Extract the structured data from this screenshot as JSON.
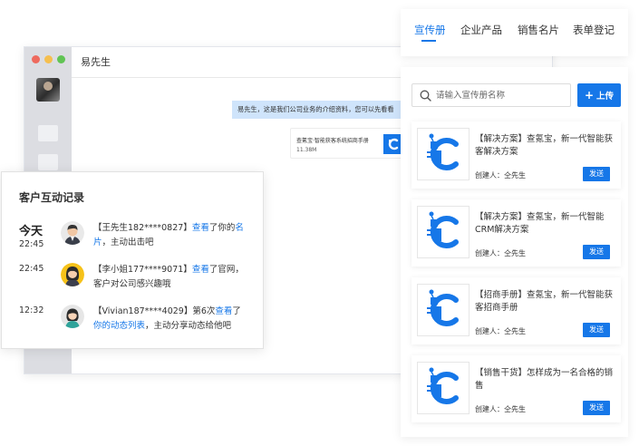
{
  "chat": {
    "contact_name": "易先生",
    "message_text": "易先生，这是我们公司业务的介绍资料，您可以先看看",
    "file_name": "查氪宝·智能获客系统招商手册",
    "file_size": "11.38M"
  },
  "interaction": {
    "title": "客户互动记录",
    "records": [
      {
        "day": "今天",
        "time": "22:45",
        "avatar": "male-avatar-icon",
        "pre": "【王先生182****0827】",
        "link1": "查看",
        "mid": "了你的",
        "link2": "名片",
        "post": "，主动出击吧"
      },
      {
        "day": "",
        "time": "22:45",
        "avatar": "female-avatar-icon",
        "pre": "【李小姐177****9071】",
        "link1": "查看",
        "mid": "了官网，客户对公司感兴趣哦",
        "link2": "",
        "post": ""
      },
      {
        "day": "",
        "time": "12:32",
        "avatar": "female-avatar-icon",
        "pre": "【Vivian187****4029】第6次",
        "link1": "查看",
        "mid": "了",
        "link2": "你的动态列表",
        "post": "，主动分享动态给他吧"
      }
    ]
  },
  "tabs": [
    {
      "label": "宣传册",
      "active": true
    },
    {
      "label": "企业产品",
      "active": false
    },
    {
      "label": "销售名片",
      "active": false
    },
    {
      "label": "表单登记",
      "active": false
    }
  ],
  "search": {
    "placeholder": "请输入宣传册名称",
    "value": ""
  },
  "upload_label": "上传",
  "brochures": [
    {
      "title": "【解决方案】查氪宝，新一代智能获客解决方案",
      "creator": "创建人：仝先生",
      "action": "发送"
    },
    {
      "title": "【解决方案】查氪宝，新一代智能CRM解决方案",
      "creator": "创建人：仝先生",
      "action": "发送"
    },
    {
      "title": "【招商手册】查氪宝，新一代智能获客招商手册",
      "creator": "创建人：仝先生",
      "action": "发送"
    },
    {
      "title": "【销售干货】怎样成为一名合格的销售",
      "creator": "创建人：仝先生",
      "action": "发送"
    }
  ],
  "colors": {
    "accent": "#1677e8",
    "bubble": "#cfe4fb"
  }
}
